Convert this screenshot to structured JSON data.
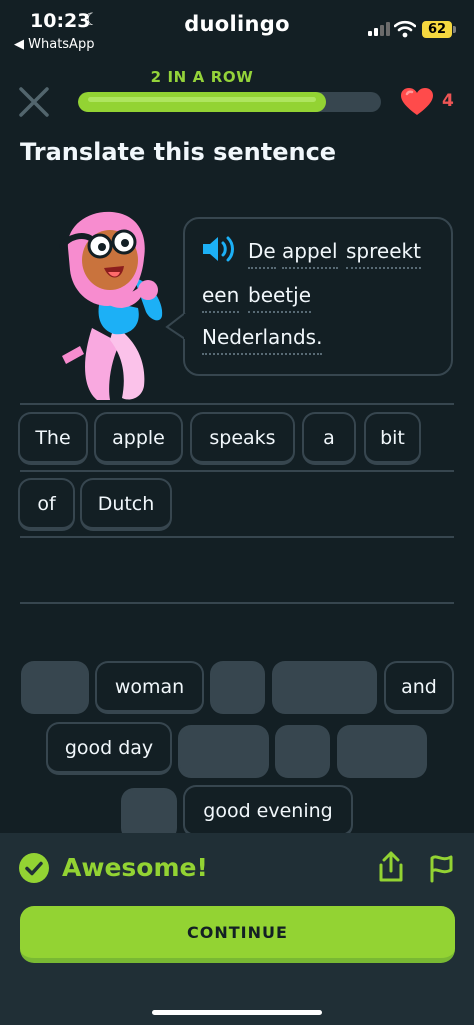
{
  "status_bar": {
    "time": "10:23",
    "back_app": "◀ WhatsApp",
    "app_name": "duolingo",
    "battery": "62",
    "icons": [
      "moon-icon",
      "signal-icon",
      "wifi-icon",
      "battery-icon"
    ]
  },
  "header": {
    "streak_text": "2 IN A ROW",
    "progress": 0.82,
    "hearts": "4",
    "icons": [
      "close-icon",
      "heart-icon"
    ]
  },
  "prompt": {
    "title": "Translate this sentence",
    "words": [
      "De",
      "appel",
      "spreekt",
      "een",
      "beetje",
      "Nederlands."
    ],
    "icons": [
      "speaker-icon"
    ]
  },
  "answer_tiles": [
    "The",
    "apple",
    "speaks",
    "a",
    "bit",
    "of",
    "Dutch"
  ],
  "word_bank": {
    "available": [
      "woman",
      "and",
      "good day",
      "good evening"
    ]
  },
  "result": {
    "title": "Awesome!",
    "continue_label": "CONTINUE",
    "icons": [
      "check-icon",
      "share-icon",
      "flag-icon"
    ]
  },
  "colors": {
    "background": "#131f24",
    "accent_green": "#93d333",
    "footer_bg": "#202f36",
    "tile_border": "#37464f",
    "heart_red": "#ff4b4b",
    "speaker_blue": "#1cb0f6"
  }
}
